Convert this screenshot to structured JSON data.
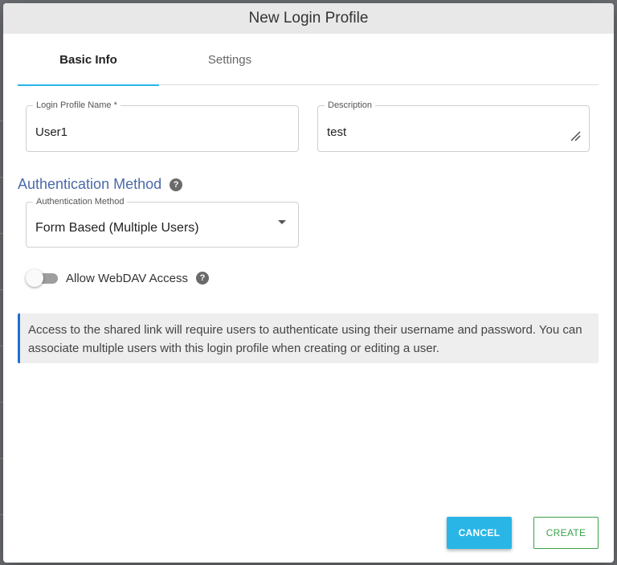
{
  "dialog": {
    "title": "New Login Profile"
  },
  "tabs": [
    {
      "label": "Basic Info",
      "active": true
    },
    {
      "label": "Settings",
      "active": false
    }
  ],
  "fields": {
    "profile_name": {
      "label": "Login Profile Name *",
      "value": "User1"
    },
    "description": {
      "label": "Description",
      "value": "test"
    }
  },
  "auth": {
    "heading": "Authentication Method",
    "select_label": "Authentication Method",
    "select_value": "Form Based (Multiple Users)"
  },
  "webdav": {
    "label": "Allow WebDAV Access",
    "enabled": false
  },
  "info": {
    "text": "Access to the shared link will require users to authenticate using their username and password. You can associate multiple users with this login profile when creating or editing a user."
  },
  "buttons": {
    "cancel": "CANCEL",
    "create": "CREATE"
  },
  "icons": {
    "help": "?",
    "help_icon_name": "help-circle-icon",
    "dropdown_icon_name": "caret-down-icon",
    "resize_icon_name": "resize-handle-icon"
  },
  "colors": {
    "accent": "#29b6e6",
    "heading": "#4a6aa8",
    "create": "#3aa24a",
    "info_border": "#1e6fd0"
  }
}
